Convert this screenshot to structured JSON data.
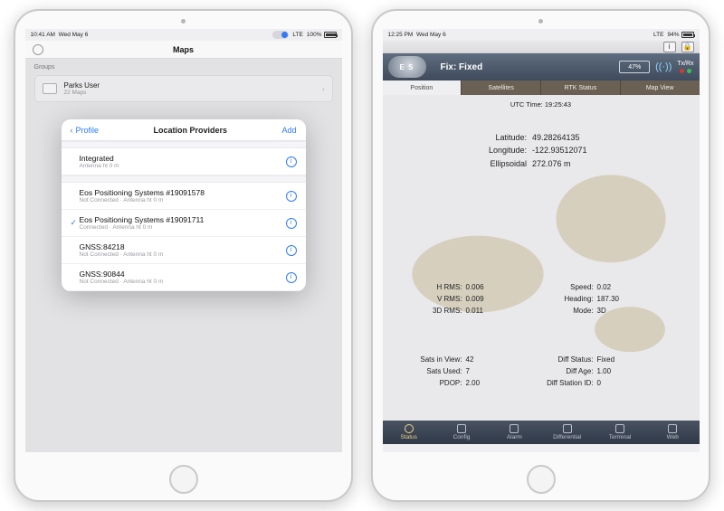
{
  "left": {
    "statusbar": {
      "time": "10:41 AM",
      "date": "Wed May 6",
      "carrier": "LTE",
      "battery_pct": "100%",
      "battery_fill": 100
    },
    "nav_title": "Maps",
    "groups_label": "Groups",
    "group": {
      "title": "Parks User",
      "subtitle": "22 Maps"
    },
    "modal": {
      "back": "Profile",
      "title": "Location Providers",
      "add": "Add",
      "section1": [
        {
          "title": "Integrated",
          "subtitle": "Antenna ht 0 m",
          "selected": false
        }
      ],
      "section2": [
        {
          "title": "Eos Positioning Systems #19091578",
          "subtitle": "Not Connected · Antenna ht 0 m",
          "selected": false
        },
        {
          "title": "Eos Positioning Systems #19091711",
          "subtitle": "Connected · Antenna ht 0 m",
          "selected": true
        },
        {
          "title": "GNSS:84218",
          "subtitle": "Not Connected · Antenna ht 0 m",
          "selected": false
        },
        {
          "title": "GNSS:90844",
          "subtitle": "Not Connected · Antenna ht 0 m",
          "selected": false
        }
      ]
    }
  },
  "right": {
    "statusbar": {
      "time": "12:25 PM",
      "date": "Wed May 6",
      "carrier": "LTE",
      "battery_pct": "94%",
      "battery_fill": 94
    },
    "topicons": {
      "info": "i",
      "lock": "🔒"
    },
    "logo": "E   S",
    "fix_label": "Fix: Fixed",
    "device_batt": "47%",
    "txrx": "Tx/Rx",
    "tabs": [
      "Position",
      "Satellites",
      "RTK Status",
      "Map View"
    ],
    "active_tab": 0,
    "utc_label": "UTC Time:",
    "utc_value": "19:25:43",
    "coords": {
      "lat_l": "Latitude:",
      "lat_v": "49.28264135",
      "lon_l": "Longitude:",
      "lon_v": "-122.93512071",
      "ell_l": "Ellipsoidal",
      "ell_v": "272.076 m"
    },
    "block1": {
      "left": [
        {
          "l": "H RMS:",
          "v": "0.006"
        },
        {
          "l": "V RMS:",
          "v": "0.009"
        },
        {
          "l": "3D RMS:",
          "v": "0.011"
        }
      ],
      "right": [
        {
          "l": "Speed:",
          "v": "0.02"
        },
        {
          "l": "Heading:",
          "v": "187.30"
        },
        {
          "l": "Mode:",
          "v": "3D"
        }
      ]
    },
    "block2": {
      "left": [
        {
          "l": "Sats in View:",
          "v": "42"
        },
        {
          "l": "Sats Used:",
          "v": "7"
        },
        {
          "l": "PDOP:",
          "v": "2.00"
        }
      ],
      "right": [
        {
          "l": "Diff Status:",
          "v": "Fixed"
        },
        {
          "l": "Diff Age:",
          "v": "1.00"
        },
        {
          "l": "Diff Station ID:",
          "v": "0"
        }
      ]
    },
    "bottom": [
      "Status",
      "Config",
      "Alarm",
      "Differential",
      "Terminal",
      "Web"
    ],
    "bottom_active": 0
  }
}
